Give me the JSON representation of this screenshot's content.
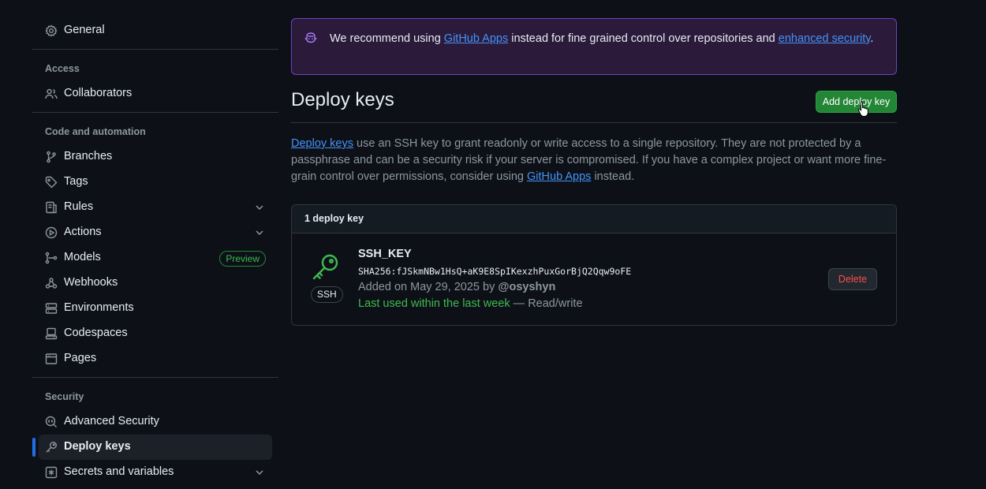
{
  "sidebar": {
    "general": "General",
    "access_heading": "Access",
    "collaborators": "Collaborators",
    "code_heading": "Code and automation",
    "branches": "Branches",
    "tags": "Tags",
    "rules": "Rules",
    "actions": "Actions",
    "models": "Models",
    "models_badge": "Preview",
    "webhooks": "Webhooks",
    "environments": "Environments",
    "codespaces": "Codespaces",
    "pages": "Pages",
    "security_heading": "Security",
    "advanced_security": "Advanced Security",
    "deploy_keys": "Deploy keys",
    "secrets": "Secrets and variables"
  },
  "banner": {
    "prefix": "We recommend using ",
    "link1": "GitHub Apps",
    "middle": " instead for fine grained control over repositories and ",
    "link2": "enhanced security",
    "suffix": "."
  },
  "page": {
    "title": "Deploy keys",
    "add_button": "Add deploy key",
    "desc_link1": "Deploy keys",
    "desc_text": " use an SSH key to grant readonly or write access to a single repository. They are not protected by a passphrase and can be a security risk if your server is compromised. If you have a complex project or want more fine-grain control over permissions, consider using ",
    "desc_link2": "GitHub Apps",
    "desc_suffix": " instead."
  },
  "keys": {
    "count_label": "1 deploy key",
    "items": [
      {
        "name": "SSH_KEY",
        "fingerprint": "SHA256:fJSkmNBw1HsQ+aK9E8SpIKexzhPuxGorBjQ2Qqw9oFE",
        "added_prefix": "Added on May 29, 2025 by ",
        "added_by": "@osyshyn",
        "last_used": "Last used within the last week",
        "access": " — Read/write",
        "type_label": "SSH",
        "delete_label": "Delete"
      }
    ]
  },
  "colors": {
    "accent_green": "#238636",
    "link_blue": "#4493f8",
    "banner_purple": "#6e40c9",
    "danger": "#f85149",
    "active_bar": "#1f6feb"
  },
  "icons": {
    "general": "gear-icon",
    "collaborators": "people-icon",
    "branches": "git-branch-icon",
    "tags": "tag-icon",
    "rules": "rules-icon",
    "actions": "play-icon",
    "models": "models-icon",
    "webhooks": "webhook-icon",
    "environments": "server-icon",
    "codespaces": "codespaces-icon",
    "pages": "browser-icon",
    "advanced_security": "codescan-icon",
    "deploy_keys": "key-icon",
    "secrets": "asterisk-icon",
    "banner": "copilot-icon"
  }
}
